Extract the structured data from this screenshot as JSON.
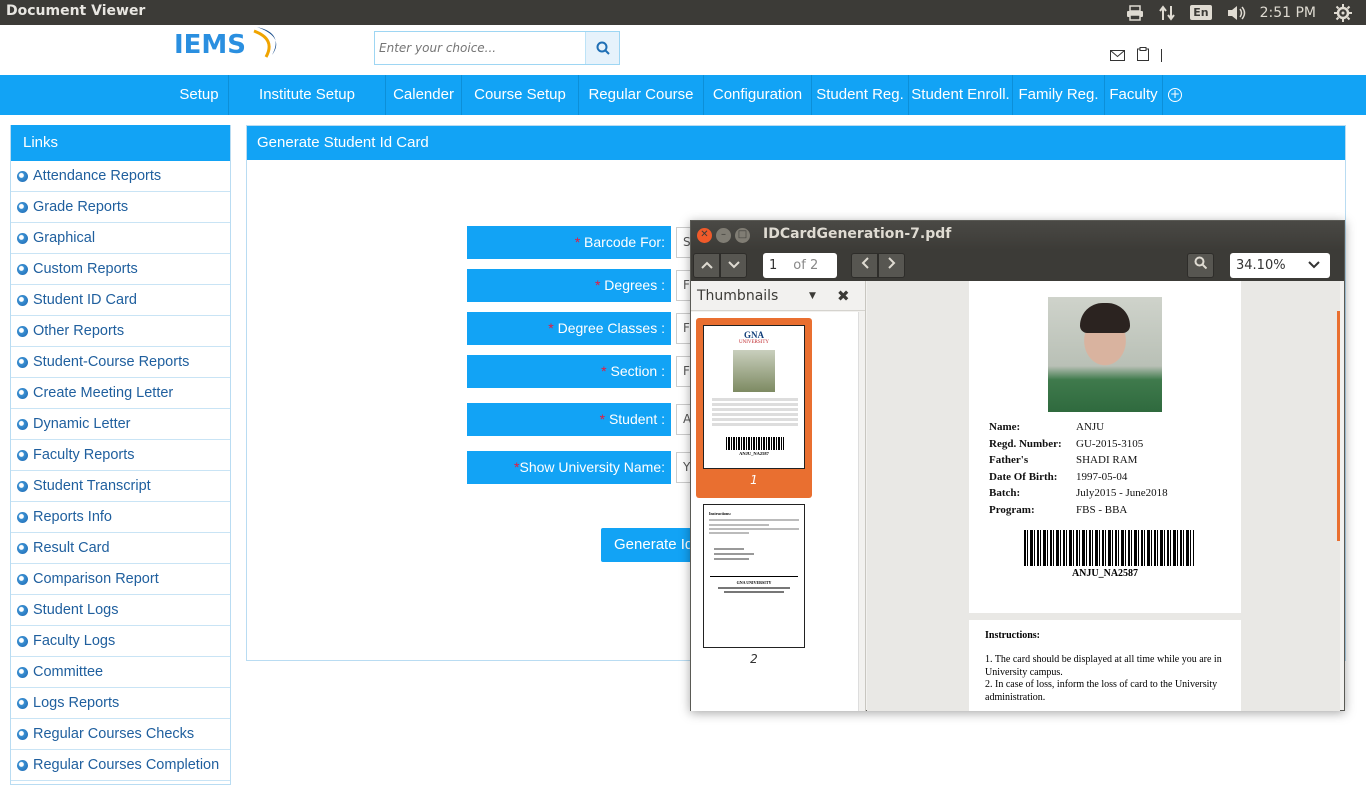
{
  "topbar": {
    "app_title": "Document Viewer",
    "keyboard": "En",
    "clock": "2:51 PM"
  },
  "header": {
    "logo_text": "IEMS",
    "search_placeholder": "Enter your choice..."
  },
  "nav": {
    "items": [
      "Setup",
      "Institute Setup",
      "Calender",
      "Course Setup",
      "Regular Course",
      "Configuration",
      "Student Reg.",
      "Student Enroll.",
      "Family Reg.",
      "Faculty"
    ]
  },
  "links": {
    "title": "Links",
    "items": [
      "Attendance Reports",
      "Grade Reports",
      "Graphical",
      "Custom Reports",
      "Student ID Card",
      "Other Reports",
      "Student-Course Reports",
      "Create Meeting Letter",
      "Dynamic Letter",
      "Faculty Reports",
      "Student Transcript",
      "Reports Info",
      "Result Card",
      "Comparison Report",
      "Student Logs",
      "Faculty Logs",
      "Committee",
      "Logs Reports",
      "Regular Courses Checks",
      "Regular Courses Completion"
    ]
  },
  "main": {
    "title": "Generate Student Id Card",
    "fields": [
      {
        "req": "*",
        "label": " Barcode For:",
        "value": "S"
      },
      {
        "req": "*",
        "label": " Degrees :",
        "value": "F"
      },
      {
        "req": "*",
        "label": " Degree Classes :",
        "value": "F"
      },
      {
        "req": "*",
        "label": " Section :",
        "value": "F"
      },
      {
        "req": "*",
        "label": " Student :",
        "value": "A"
      },
      {
        "req": "*",
        "label": "Show University Name:",
        "value": "Y"
      }
    ],
    "generate_label": "Generate Id"
  },
  "pdf": {
    "title": "IDCardGeneration-7.pdf",
    "page": "1",
    "page_of": "of 2",
    "zoom": "34.10%",
    "sidebar_title": "Thumbnails",
    "thumb_nums": [
      "1",
      "2"
    ],
    "thumb1": {
      "uni_name": "GNA",
      "uni_sub": "UNIVERSITY",
      "barcode_id": "ANJU_NA2587"
    },
    "thumb2": {
      "header": "Instructions:",
      "footer": "GNA UNIVERSITY"
    },
    "card": {
      "fields": [
        {
          "k": "Name:",
          "v": "ANJU"
        },
        {
          "k": "Regd. Number:",
          "v": "GU-2015-3105"
        },
        {
          "k": "Father's",
          "v": "SHADI RAM"
        },
        {
          "k": "Date Of Birth:",
          "v": "1997-05-04"
        },
        {
          "k": "Batch:",
          "v": "July2015 - June2018"
        },
        {
          "k": "Program:",
          "v": "FBS -  BBA"
        }
      ],
      "barcode_id": "ANJU_NA2587"
    },
    "instructions": {
      "title": "Instructions:",
      "lines": [
        "1. The card should be displayed at all time while you are in",
        "University campus.",
        "2. In case of loss, inform the loss of card to the University",
        "administration."
      ]
    }
  },
  "colors": {
    "primary": "#12a3f5",
    "link": "#1f5f9e",
    "ubuntu_panel": "#3c3b37",
    "thumb_highlight": "#e96f30"
  }
}
